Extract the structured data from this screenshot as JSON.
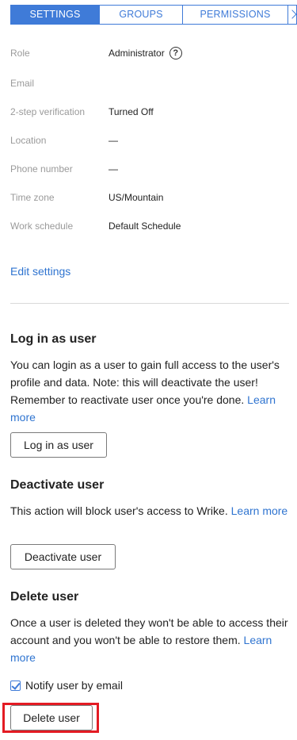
{
  "tabs": {
    "settings": "SETTINGS",
    "groups": "GROUPS",
    "permissions": "PERMISSIONS"
  },
  "info": {
    "role_label": "Role",
    "role_value": "Administrator",
    "help_glyph": "?",
    "email_label": "Email",
    "twostep_label": "2-step verification",
    "twostep_value": "Turned Off",
    "location_label": "Location",
    "location_value": "—",
    "phone_label": "Phone number",
    "phone_value": "—",
    "timezone_label": "Time zone",
    "timezone_value": "US/Mountain",
    "schedule_label": "Work schedule",
    "schedule_value": "Default Schedule"
  },
  "edit_settings": "Edit settings",
  "login": {
    "title": "Log in as user",
    "text": "You can login as a user to gain full access to the user's profile and data. Note: this will deactivate the user! Remember to reactivate user once you're done.",
    "learn_more": "Learn more",
    "button": "Log in as user"
  },
  "deactivate": {
    "title": "Deactivate user",
    "text": "This action will block user's access to Wrike.",
    "learn_more": "Learn more",
    "button": "Deactivate user"
  },
  "delete": {
    "title": "Delete user",
    "text": "Once a user is deleted they won't be able to access their account and you won't be able to restore them.",
    "learn_more": "Learn more",
    "notify_label": "Notify user by email",
    "notify_checked": true,
    "button": "Delete user"
  },
  "colors": {
    "accent": "#3f7bd8",
    "link": "#2f74d0",
    "highlight": "#e31b23"
  }
}
